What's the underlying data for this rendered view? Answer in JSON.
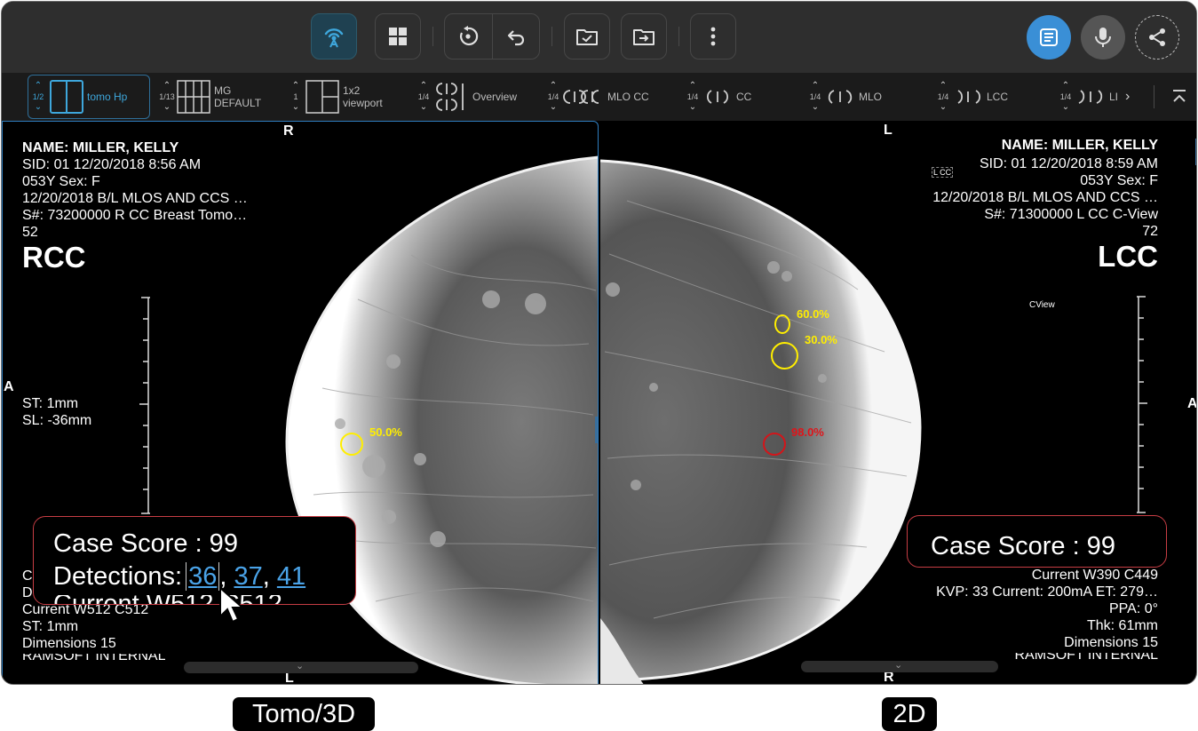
{
  "toolbar": {
    "buttons": [
      {
        "icon": "broadcast-icon",
        "active": true
      },
      {
        "icon": "grid-icon"
      },
      {
        "icon": "rotate-reset-icon"
      },
      {
        "icon": "undo-icon"
      },
      {
        "icon": "folder-check-icon"
      },
      {
        "icon": "folder-import-icon"
      },
      {
        "icon": "more-vert-icon"
      }
    ],
    "right": [
      {
        "icon": "report-icon",
        "color": "#3a8fd6"
      },
      {
        "icon": "mic-icon",
        "color": "#555555"
      },
      {
        "icon": "share-icon"
      }
    ]
  },
  "layout_bar": {
    "selected": {
      "counter": "1/2",
      "label": "tomo Hp"
    },
    "items": [
      {
        "counter": "1/13",
        "label_line1": "MG",
        "label_line2": "DEFAULT"
      },
      {
        "counter": "1",
        "label_line1": "1x2",
        "label_line2": "viewport"
      },
      {
        "counter": "1/4",
        "label": "Overview"
      },
      {
        "counter": "1/4",
        "label": "MLO CC"
      },
      {
        "counter": "1/4",
        "label": "CC"
      },
      {
        "counter": "1/4",
        "label": "MLO"
      },
      {
        "counter": "1/4",
        "label": "LCC"
      },
      {
        "counter": "1/4",
        "label": "LI"
      }
    ],
    "next": "›",
    "collapse": "⌃"
  },
  "left_viewport": {
    "orient_top": "R",
    "orient_left": "A",
    "orient_bottom": "L",
    "name": "NAME: MILLER, KELLY",
    "sid": "SID: 01  12/20/2018 8:56 AM",
    "age_sex": "053Y  Sex: F",
    "study": "12/20/2018  B/L MLOS AND CCS …",
    "series": "S#: 73200000  R CC Breast Tomo…",
    "image_num": "52",
    "view": "RCC",
    "st": "ST: 1mm",
    "sl": "SL: -36mm",
    "bl_line1": "C",
    "bl_line2": "D",
    "current": "Current  W512 C512",
    "st2": "ST: 1mm",
    "dimensions": "Dimensions 15",
    "institution": "RAMSOFT INTERNAL",
    "detections": [
      {
        "pct": "50.0%",
        "color": "#ffee00"
      }
    ],
    "score_box": {
      "score_label": "Case Score : 99",
      "detections_label": "Detections:",
      "links": [
        "36",
        "37",
        "41"
      ],
      "overflow": "Current  W512  C512"
    }
  },
  "right_viewport": {
    "orient_top": "L",
    "orient_right": "A",
    "orient_bottom": "R",
    "name": "NAME: MILLER, KELLY",
    "sid": "SID: 01  12/20/2018 8:59 AM",
    "age_sex": "053Y  Sex: F",
    "study": "12/20/2018  B/L MLOS AND CCS …",
    "series": "S#: 71300000  L CC C-View",
    "image_num": "72",
    "view": "LCC",
    "cview": "CView",
    "lcc_tag": "L CC",
    "current": "Current  W390 C449",
    "kvp": "KVP: 33  Current: 200mA  ET: 279…",
    "ppa": "PPA: 0°",
    "thk": "Thk: 61mm",
    "dimensions": "Dimensions 15",
    "institution": "RAMSOFT INTERNAL",
    "detections": [
      {
        "pct": "60.0%",
        "color": "#ffee00"
      },
      {
        "pct": "30.0%",
        "color": "#ffee00"
      },
      {
        "pct": "98.0%",
        "color": "#e0141a"
      }
    ],
    "score_box": {
      "score_label": "Case Score : 99"
    }
  },
  "captions": {
    "left": "Tomo/3D",
    "right": "2D"
  },
  "colors": {
    "accent": "#3a8fd6",
    "link": "#4aa3e8",
    "detection_yellow": "#ffee00",
    "detection_red": "#e0141a",
    "score_border": "#c73d44"
  }
}
